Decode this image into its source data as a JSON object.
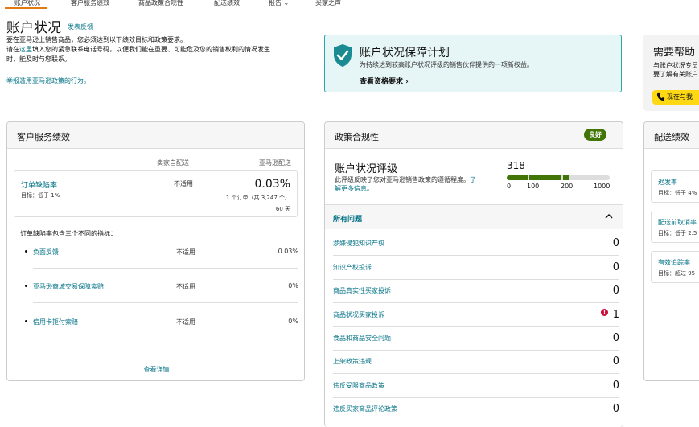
{
  "nav": {
    "tabs": [
      "账户状况",
      "客户服务绩效",
      "商品政策合规性",
      "配送绩效",
      "报告 ⌄",
      "买家之声"
    ]
  },
  "header": {
    "title": "账户状况",
    "feedback": "发表反馈",
    "intro_line1": "要在亚马逊上销售商品，您必须达到以下绩效目标和政策要求。",
    "intro_line2_prefix": "请在",
    "intro_line2_link": "这里",
    "intro_line2_suffix": "填入您的紧急联系电话号码，以便我们能在重要、可能危及您的销售权利的情况发生",
    "intro_line3": "时，能及时与您联系。",
    "report_link": "举报滥用亚马逊政策的行为。"
  },
  "banner": {
    "title": "账户状况保障计划",
    "desc": "为持续达到较高账户状况评级的销售伙伴提供的一项新权益。",
    "link": "查看资格要求 ›"
  },
  "help": {
    "title": "需要帮助",
    "desc1": "与账户状况专员",
    "desc2": "要了解有关账户",
    "button": "现在与我"
  },
  "customer_service": {
    "title": "客户服务绩效",
    "col_seller": "卖家自配送",
    "col_amazon": "亚马逊配送",
    "odr": {
      "name": "订单缺陷率",
      "target": "目标：低于 1%",
      "seller_value": "不适用",
      "rate": "0.03%",
      "count": "1 个订单（共 3,247 个）",
      "days": "60 天"
    },
    "metrics_intro": "订单缺陷率包含三个不同的指标：",
    "metrics": [
      {
        "name": "负面反馈",
        "seller": "不适用",
        "amazon": "0.03%"
      },
      {
        "name": "亚马逊商城交易保障索赔",
        "seller": "不适用",
        "amazon": "0%"
      },
      {
        "name": "信用卡拒付索赔",
        "seller": "不适用",
        "amazon": "0%"
      }
    ],
    "view_details": "查看详情"
  },
  "policy": {
    "title": "政策合规性",
    "badge": "良好",
    "ahr_title": "账户状况评级",
    "ahr_desc": "此评级反映了您对亚马逊销售政策的遵循程度。",
    "ahr_learn": "了解更多信息。",
    "score": "318",
    "ahr_score_value": 318,
    "ticks": [
      "0",
      "100",
      "200",
      "1000"
    ],
    "issues_title": "所有问题",
    "issues": [
      {
        "label": "涉嫌侵犯知识产权",
        "count": "0",
        "alert": false
      },
      {
        "label": "知识产权投诉",
        "count": "0",
        "alert": false
      },
      {
        "label": "商品真实性买家投诉",
        "count": "0",
        "alert": false
      },
      {
        "label": "商品状况买家投诉",
        "count": "1",
        "alert": true
      },
      {
        "label": "食品和商品安全问题",
        "count": "0",
        "alert": false
      },
      {
        "label": "上架政策违规",
        "count": "0",
        "alert": false
      },
      {
        "label": "违反受限商品政策",
        "count": "0",
        "alert": false
      },
      {
        "label": "违反买家商品评论政策",
        "count": "0",
        "alert": false
      }
    ],
    "alert_mark": "!"
  },
  "shipping": {
    "title": "配送绩效",
    "items": [
      {
        "name": "迟发率",
        "target": "目标：低于 4%"
      },
      {
        "name": "配送前取消率",
        "target": "目标：低于 2.5"
      },
      {
        "name": "有效追踪率",
        "target": "目标：超过 95"
      }
    ]
  },
  "colors": {
    "link": "#007185",
    "accent_teal": "#2aa4ad",
    "good_green": "#417505",
    "alert_red": "#cc0c39",
    "help_yellow": "#ffd814"
  }
}
